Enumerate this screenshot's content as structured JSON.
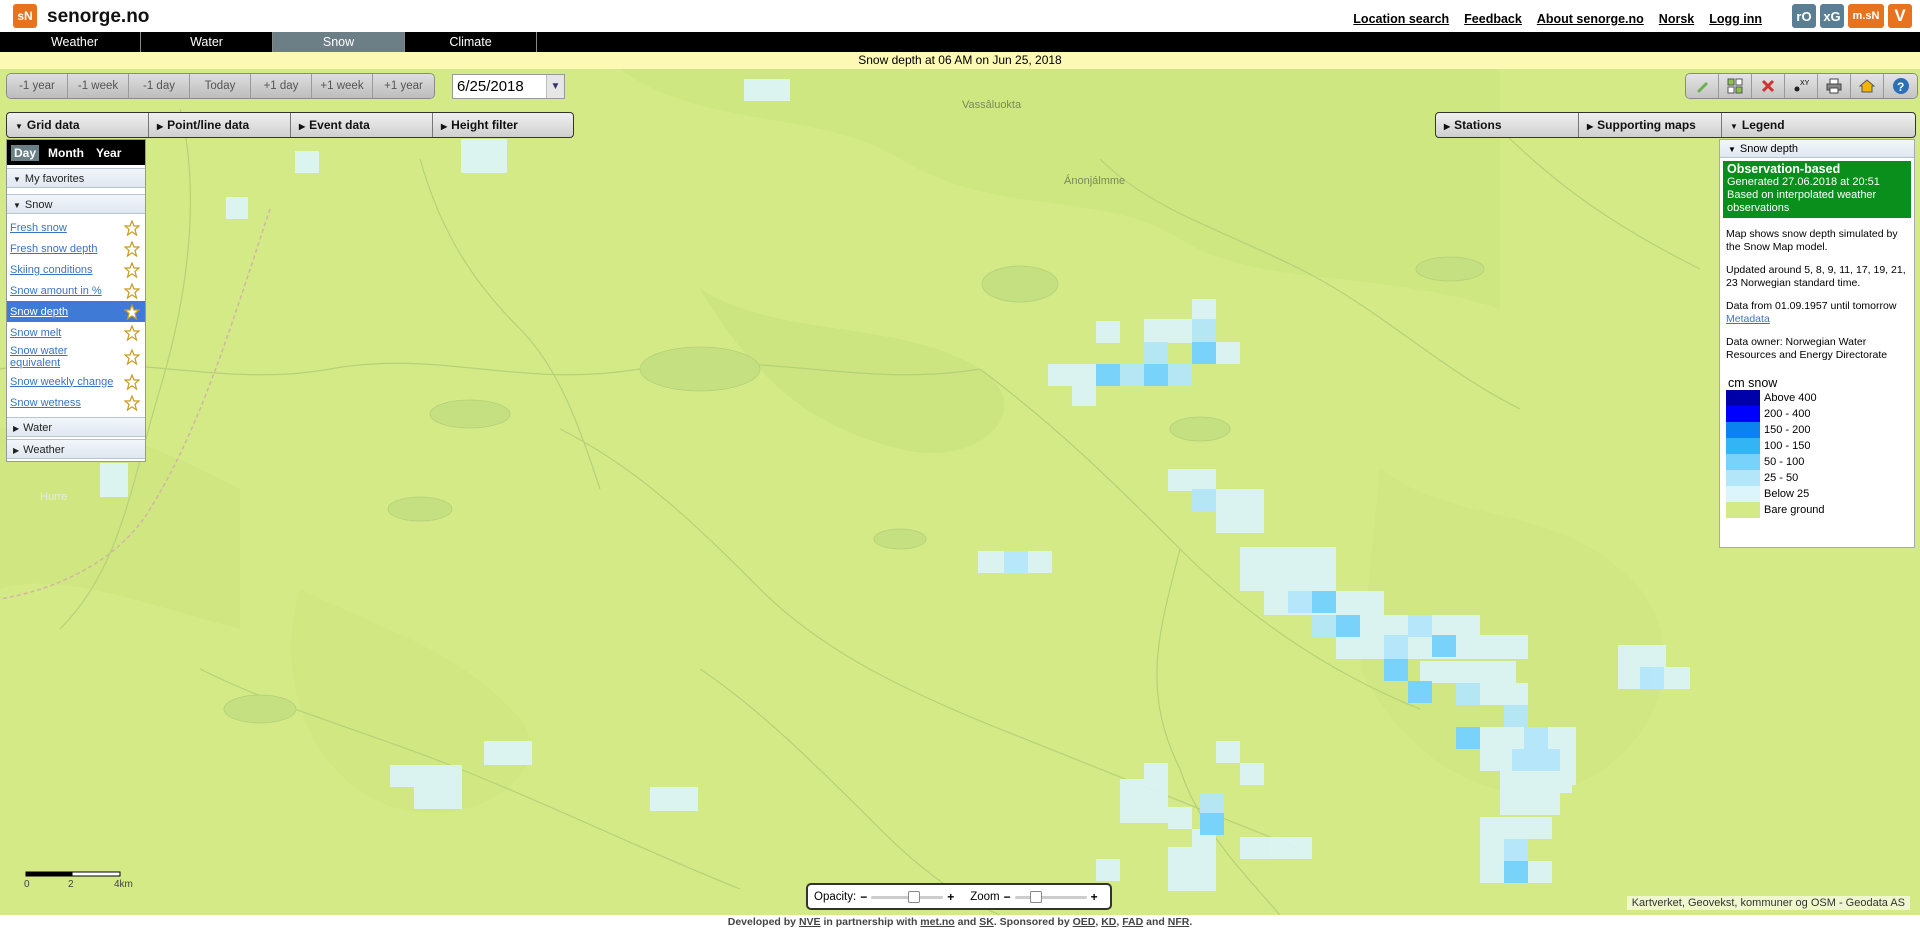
{
  "header": {
    "logo": "sN",
    "title": "senorge.no",
    "links": [
      "Location search",
      "Feedback",
      "About senorge.no",
      "Norsk",
      "Logg inn"
    ],
    "partners": [
      {
        "text": "rO",
        "color": "#5a7f94"
      },
      {
        "text": "xG",
        "color": "#5a7f94"
      },
      {
        "text": "m.sN",
        "color": "#e8731f"
      },
      {
        "text": "V",
        "color": "#e8731f"
      }
    ]
  },
  "nav": {
    "tabs": [
      "Weather",
      "Water",
      "Snow",
      "Climate"
    ],
    "active": "Snow"
  },
  "title_strip": "Snow depth at 06 AM  on Jun 25, 2018",
  "date_nav": {
    "buttons": [
      "-1 year",
      "-1 week",
      "-1 day",
      "Today",
      "+1 day",
      "+1 week",
      "+1 year"
    ],
    "date_value": "6/25/2018"
  },
  "tools": [
    "draw-icon",
    "grid-icon",
    "clear-icon",
    "xy-coordinates-icon",
    "print-icon",
    "home-icon",
    "help-icon"
  ],
  "panels_left": [
    "Grid data",
    "Point/line data",
    "Event data",
    "Height filter"
  ],
  "panels_right": [
    "Stations",
    "Supporting maps",
    "Legend"
  ],
  "left_panel": {
    "period_tabs": [
      "Day",
      "Month",
      "Year"
    ],
    "active_period": "Day",
    "favorites": "My favorites",
    "snow_section": "Snow",
    "snow_layers": [
      "Fresh snow",
      "Fresh snow depth",
      "Skiing conditions",
      "Snow amount in %",
      "Snow depth",
      "Snow melt",
      "Snow water equivalent",
      "Snow weekly change",
      "Snow wetness"
    ],
    "selected_layer": "Snow depth",
    "water_section": "Water",
    "weather_section": "Weather"
  },
  "legend": {
    "section": "Snow depth",
    "obs_title": "Observation-based",
    "obs_generated": "Generated 27.06.2018 at 20:51",
    "obs_basis": "Based on interpolated weather observations",
    "description": "Map shows snow depth simulated by the Snow Map model.",
    "updated": "Updated around 5, 8, 9, 11, 17, 19, 21, 23 Norwegian standard time.",
    "data_range": "Data from 01.09.1957 until tomorrow",
    "metadata_link": "Metadata",
    "owner": "Data owner: Norwegian Water Resources and Energy Directorate",
    "unit": "cm snow",
    "classes": [
      {
        "label": "Above  400",
        "color": "#0000a8"
      },
      {
        "label": "200 - 400",
        "color": "#0000ff"
      },
      {
        "label": "150 - 200",
        "color": "#0a82f0"
      },
      {
        "label": "100 - 150",
        "color": "#32b4f5"
      },
      {
        "label": "50 - 100",
        "color": "#78d2fa"
      },
      {
        "label": "25 - 50",
        "color": "#b4e6fa"
      },
      {
        "label": "Below 25",
        "color": "#dcf5fc"
      },
      {
        "label": "Bare ground",
        "color": "#d4ea86"
      }
    ]
  },
  "map": {
    "place_names": [
      "Vassâluokta",
      "Ánonjálmme",
      "Hurre"
    ]
  },
  "controls": {
    "opacity_label": "Opacity:",
    "opacity_level": 0.6,
    "zoom_label": "Zoom",
    "zoom_level": 0.3
  },
  "scale": {
    "labels": [
      "0",
      "2",
      "4km"
    ]
  },
  "attribution": "Kartverket, Geovekst, kommuner og OSM - Geodata AS",
  "footer": {
    "text_1": "Developed by",
    "nve": "NVE",
    "text_2": "in partnership with",
    "met": "met.no",
    "text_3": "and",
    "sk": "SK",
    "text_4": ". Sponsored by",
    "oed": "OED",
    "kd": "KD",
    "fad": "FAD",
    "text_5": "and",
    "nfr": "NFR",
    "text_6": "."
  }
}
